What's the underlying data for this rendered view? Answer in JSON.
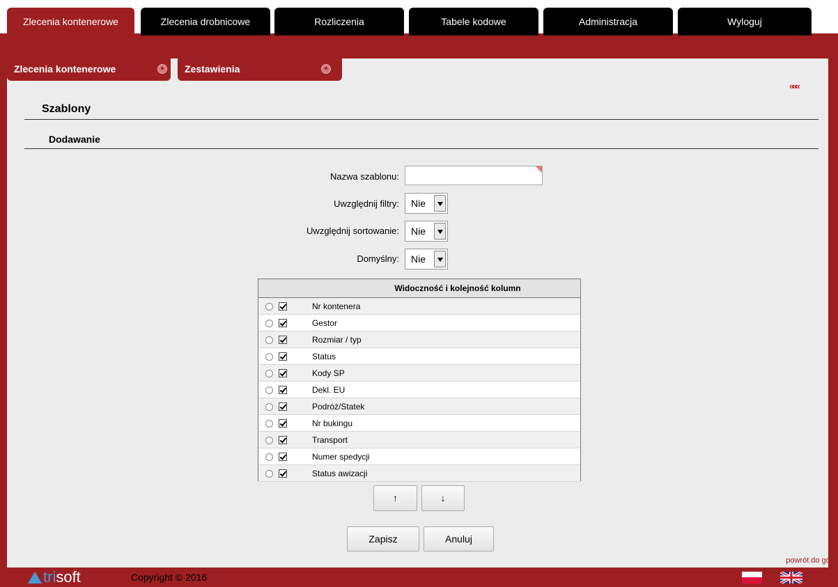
{
  "nav": {
    "tabs": [
      {
        "label": "Zlecenia kontenerowe"
      },
      {
        "label": "Zlecenia drobnicowe"
      },
      {
        "label": "Rozliczenia"
      },
      {
        "label": "Tabele kodowe"
      },
      {
        "label": "Administracja"
      },
      {
        "label": "Wyloguj"
      }
    ]
  },
  "subtabs": [
    {
      "label": "Zlecenia kontenerowe"
    },
    {
      "label": "Zestawienia"
    }
  ],
  "back_arrows": "«««",
  "section": {
    "title": "Szablony",
    "subtitle": "Dodawanie"
  },
  "form": {
    "name_label": "Nazwa szablonu:",
    "name_value": "",
    "filters_label": "Uwzględnij filtry:",
    "filters_value": "Nie",
    "sorting_label": "Uwzględnij sortowanie:",
    "sorting_value": "Nie",
    "default_label": "Domyślny:",
    "default_value": "Nie"
  },
  "columns_table": {
    "header": "Widoczność i kolejność kolumn",
    "rows": [
      {
        "label": "Nr kontenera",
        "checked": true
      },
      {
        "label": "Gestor",
        "checked": true
      },
      {
        "label": "Rozmiar / typ",
        "checked": true
      },
      {
        "label": "Status",
        "checked": true
      },
      {
        "label": "Kody SP",
        "checked": true
      },
      {
        "label": "Dekl. EU",
        "checked": true
      },
      {
        "label": "Podróż/Statek",
        "checked": true
      },
      {
        "label": "Nr bukingu",
        "checked": true
      },
      {
        "label": "Transport",
        "checked": true
      },
      {
        "label": "Numer spedycji",
        "checked": true
      },
      {
        "label": "Status awizacji",
        "checked": true
      }
    ]
  },
  "buttons": {
    "up": "↑",
    "down": "↓",
    "save": "Zapisz",
    "cancel": "Anuluj"
  },
  "footer": {
    "logo_prefix": "tri",
    "logo_suffix": "soft",
    "copyright": "Copyright © 2016",
    "back_to_top": "powrót do góry"
  },
  "colors": {
    "brand": "#9e1f22",
    "content_bg": "#ececec"
  }
}
